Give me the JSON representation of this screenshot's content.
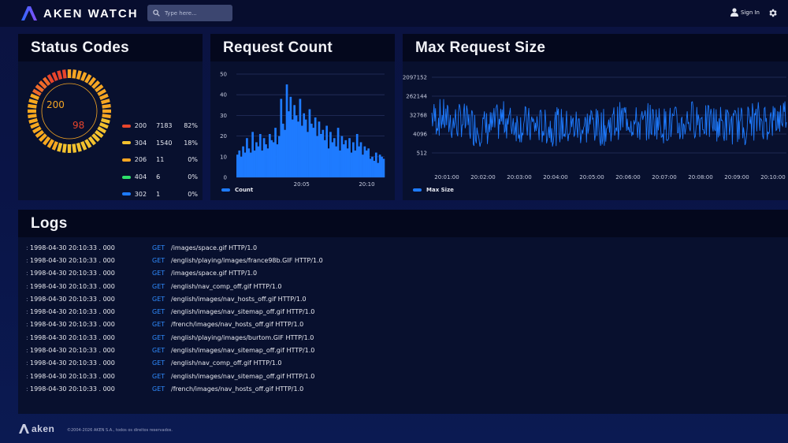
{
  "header": {
    "brand": "AKEN WATCH",
    "search_placeholder": "Type here...",
    "signin_label": "Sign In"
  },
  "status_panel": {
    "title": "Status Codes",
    "gauge": {
      "label_primary": "200",
      "label_secondary": "98",
      "fill_fraction": 0.82
    },
    "legend": [
      {
        "code": "200",
        "count": "7183",
        "pct": "82%",
        "color": "#e8452c"
      },
      {
        "code": "304",
        "count": "1540",
        "pct": "18%",
        "color": "#f2c12e"
      },
      {
        "code": "206",
        "count": "11",
        "pct": "0%",
        "color": "#f6a623"
      },
      {
        "code": "404",
        "count": "6",
        "pct": "0%",
        "color": "#2ee06a"
      },
      {
        "code": "302",
        "count": "1",
        "pct": "0%",
        "color": "#1e7bff"
      }
    ]
  },
  "count_panel": {
    "title": "Request Count",
    "legend_label": "Count"
  },
  "size_panel": {
    "title": "Max Request Size",
    "legend_label": "Max Size"
  },
  "chart_data": [
    {
      "type": "bar",
      "series": [
        {
          "name": "Count",
          "color": "#1e7bff"
        }
      ],
      "ylim": [
        0,
        50
      ],
      "y_ticks": [
        "0",
        "10",
        "20",
        "30",
        "40",
        "50"
      ],
      "x_ticks": [
        {
          "label": "20:05",
          "frac": 0.44
        },
        {
          "label": "20:10",
          "frac": 0.88
        }
      ],
      "values": [
        11,
        13,
        10,
        15,
        12,
        19,
        14,
        12,
        22,
        13,
        17,
        15,
        21,
        13,
        19,
        16,
        14,
        21,
        18,
        17,
        24,
        16,
        20,
        38,
        26,
        23,
        45,
        32,
        39,
        28,
        35,
        30,
        27,
        38,
        25,
        31,
        28,
        22,
        33,
        26,
        24,
        29,
        20,
        27,
        21,
        23,
        18,
        25,
        14,
        22,
        17,
        19,
        15,
        24,
        13,
        20,
        16,
        18,
        14,
        19,
        12,
        17,
        13,
        21,
        15,
        17,
        11,
        15,
        13,
        14,
        9,
        10,
        8,
        12,
        7,
        11,
        10,
        9
      ]
    },
    {
      "type": "line",
      "series": [
        {
          "name": "Max Size",
          "color": "#1e7bff"
        }
      ],
      "scale": "log",
      "y_ticks": [
        "512",
        "4096",
        "32768",
        "262144",
        "2097152"
      ],
      "x_ticks": [
        "20:01:00",
        "20:02:00",
        "20:03:00",
        "20:04:00",
        "20:05:00",
        "20:06:00",
        "20:07:00",
        "20:08:00",
        "20:09:00",
        "20:10:00"
      ],
      "log2_range": [
        8,
        22
      ],
      "point_count": 480
    }
  ],
  "logs": {
    "title": "Logs",
    "rows": [
      {
        "ts": "1998-04-30  20:10:33 . 000",
        "method": "GET",
        "path": "/images/space.gif HTTP/1.0"
      },
      {
        "ts": "1998-04-30  20:10:33 . 000",
        "method": "GET",
        "path": "/english/playing/images/france98b.GIF HTTP/1.0"
      },
      {
        "ts": "1998-04-30  20:10:33 . 000",
        "method": "GET",
        "path": "/images/space.gif HTTP/1.0"
      },
      {
        "ts": "1998-04-30  20:10:33 . 000",
        "method": "GET",
        "path": "/english/nav_comp_off.gif HTTP/1.0"
      },
      {
        "ts": "1998-04-30  20:10:33 . 000",
        "method": "GET",
        "path": "/english/images/nav_hosts_off.gif HTTP/1.0"
      },
      {
        "ts": "1998-04-30  20:10:33 . 000",
        "method": "GET",
        "path": "/english/images/nav_sitemap_off.gif HTTP/1.0"
      },
      {
        "ts": "1998-04-30  20:10:33 . 000",
        "method": "GET",
        "path": "/french/images/nav_hosts_off.gif HTTP/1.0"
      },
      {
        "ts": "1998-04-30  20:10:33 . 000",
        "method": "GET",
        "path": "/english/playing/images/burtom.GIF HTTP/1.0"
      },
      {
        "ts": "1998-04-30  20:10:33 . 000",
        "method": "GET",
        "path": "/english/images/nav_sitemap_off.gif HTTP/1.0"
      },
      {
        "ts": "1998-04-30  20:10:33 . 000",
        "method": "GET",
        "path": "/english/nav_comp_off.gif HTTP/1.0"
      },
      {
        "ts": "1998-04-30  20:10:33 . 000",
        "method": "GET",
        "path": "/english/images/nav_sitemap_off.gif HTTP/1.0"
      },
      {
        "ts": "1998-04-30  20:10:33 . 000",
        "method": "GET",
        "path": "/french/images/nav_hosts_off.gif HTTP/1.0"
      }
    ]
  },
  "footer": {
    "brand": "aken",
    "copyright": "©2004-2026 AKEN S.A., todos os direitos reservados."
  }
}
